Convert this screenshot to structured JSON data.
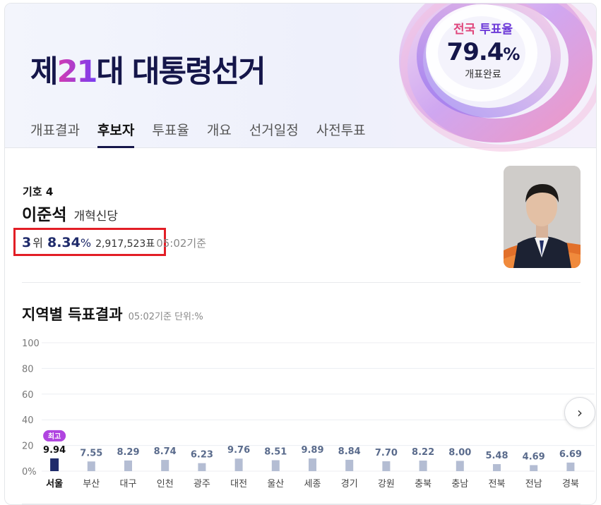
{
  "header": {
    "title_prefix": "제",
    "title_number": "21",
    "title_suffix": "대 대통령선거",
    "turnout": {
      "label_a": "전국",
      "label_b": "투표율",
      "value": "79.4",
      "unit": "%",
      "status": "개표완료"
    }
  },
  "tabs": [
    {
      "label": "개표결과",
      "active": false
    },
    {
      "label": "후보자",
      "active": true
    },
    {
      "label": "투표율",
      "active": false
    },
    {
      "label": "개요",
      "active": false
    },
    {
      "label": "선거일정",
      "active": false
    },
    {
      "label": "사전투표",
      "active": false
    }
  ],
  "candidate": {
    "number_label": "기호 4",
    "name": "이준석",
    "party": "개혁신당",
    "rank": "3",
    "rank_unit": "위",
    "rate": "8.34",
    "rate_unit": "%",
    "votes": "2,917,523표",
    "time_ref": "05:02기준"
  },
  "regional": {
    "title": "지역별 득표결과",
    "subtitle": "05:02기준 단위:%",
    "highest_badge": "최고"
  },
  "chart_data": {
    "type": "bar",
    "categories": [
      "서울",
      "부산",
      "대구",
      "인천",
      "광주",
      "대전",
      "울산",
      "세종",
      "경기",
      "강원",
      "충북",
      "충남",
      "전북",
      "전남",
      "경북"
    ],
    "values": [
      9.94,
      7.55,
      8.29,
      8.74,
      6.23,
      9.76,
      8.51,
      9.89,
      8.84,
      7.7,
      8.22,
      8.0,
      5.48,
      4.69,
      6.69
    ],
    "value_labels": [
      "9.94",
      "7.55",
      "8.29",
      "8.74",
      "6.23",
      "9.76",
      "8.51",
      "9.89",
      "8.84",
      "7.70",
      "8.22",
      "8.00",
      "5.48",
      "4.69",
      "6.69"
    ],
    "y_ticks": [
      "100",
      "80",
      "60",
      "40",
      "20",
      "0%"
    ],
    "ylim": [
      0,
      100
    ],
    "highest_index": 0,
    "grid": true,
    "colors": {
      "highest": "#1f2b6b",
      "default": "#b4bdd3",
      "grid": "#eceef2"
    }
  }
}
